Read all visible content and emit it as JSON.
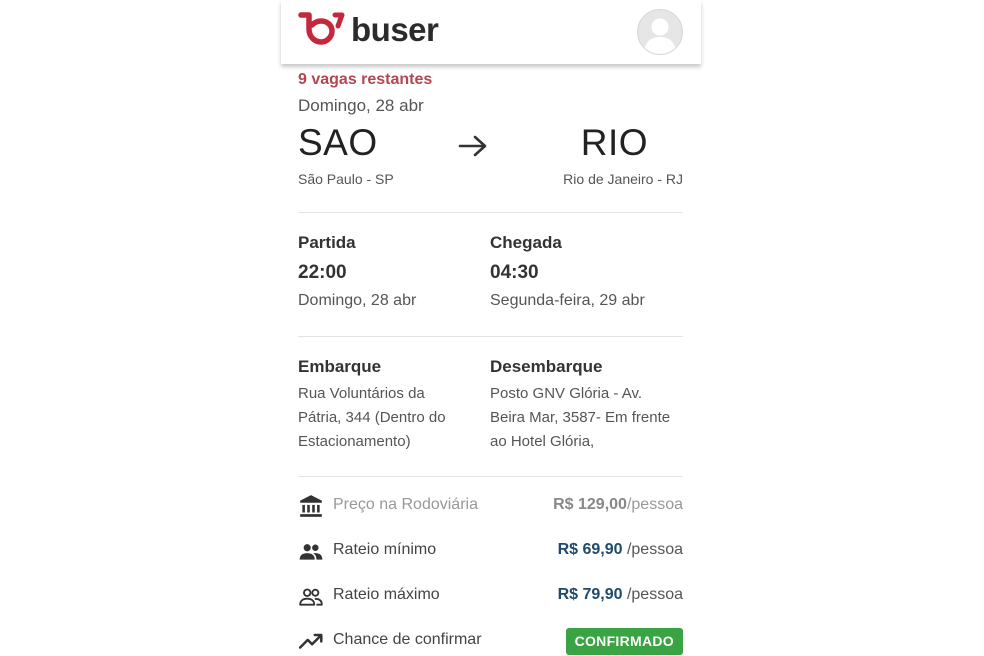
{
  "header": {
    "brand": "buser",
    "brand_color": "#c5283d",
    "logo_icon": "buser-logo-icon",
    "avatar_icon": "user-avatar-icon"
  },
  "trip": {
    "availability": "9 vagas restantes",
    "date": "Domingo, 28 abr",
    "origin_code": "SAO",
    "origin_city": "São Paulo - SP",
    "destination_code": "RIO",
    "destination_city": "Rio de Janeiro - RJ",
    "arrow_icon": "arrow-right-icon"
  },
  "schedule": {
    "departure": {
      "title": "Partida",
      "time": "22:00",
      "date": "Domingo, 28 abr"
    },
    "arrival": {
      "title": "Chegada",
      "time": "04:30",
      "date": "Segunda-feira, 29 abr"
    }
  },
  "locations": {
    "boarding": {
      "title": "Embarque",
      "line1": "Rua Voluntários da",
      "line2": "Pátria, 344 (Dentro do",
      "line3": "Estacionamento)"
    },
    "dropoff": {
      "title": "Desembarque",
      "line1": "Posto GNV Glória - Av.",
      "line2": "Beira Mar, 3587- Em frente",
      "line3": "ao Hotel Glória,"
    }
  },
  "pricing": {
    "station": {
      "icon": "bank-icon",
      "label": "Preço na Rodoviária",
      "amount": "R$ 129,00",
      "unit": "/pessoa"
    },
    "min": {
      "icon": "group-icon",
      "label": "Rateio mínimo",
      "amount": "R$ 69,90",
      "unit": " /pessoa"
    },
    "max": {
      "icon": "group-outline-icon",
      "label": "Rateio máximo",
      "amount": "R$ 79,90",
      "unit": " /pessoa"
    },
    "chance": {
      "icon": "trending-up-icon",
      "label": "Chance de confirmar",
      "status": "CONFIRMADO",
      "status_color": "#3aa344"
    }
  }
}
